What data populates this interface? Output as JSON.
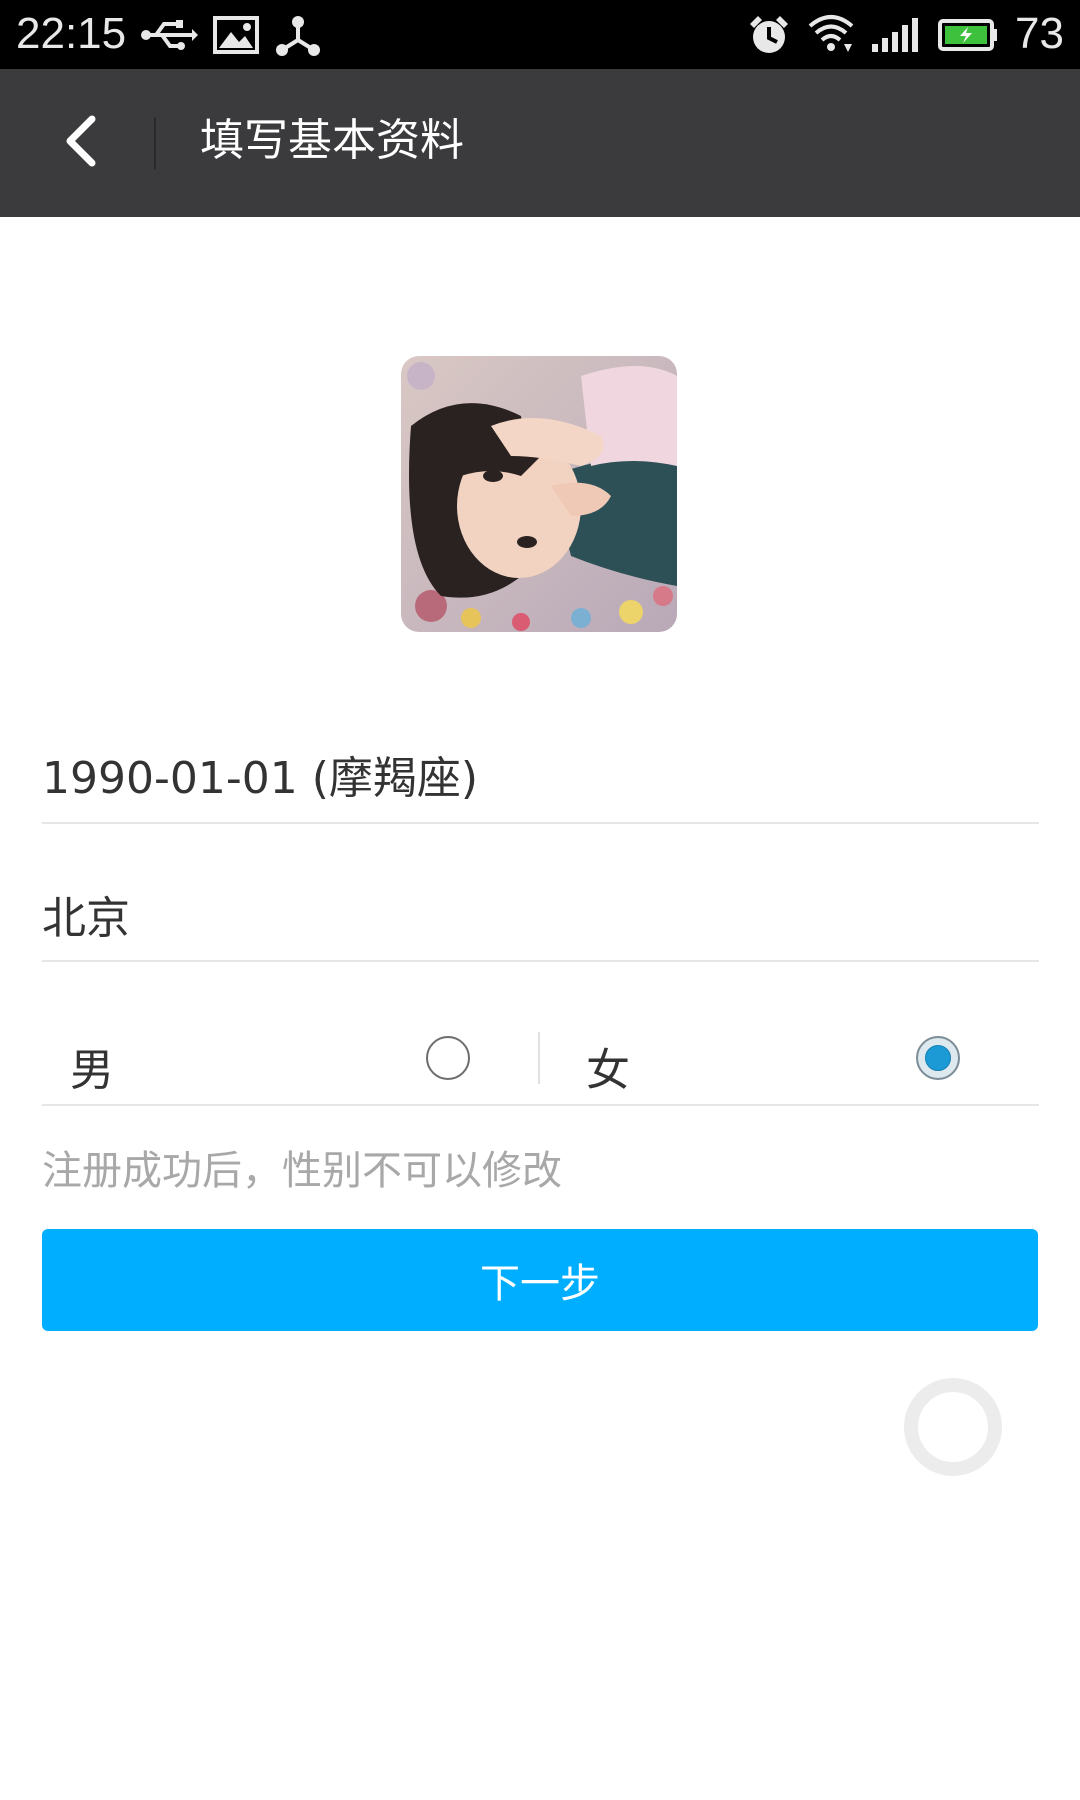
{
  "status_bar": {
    "time": "22:15",
    "battery": "73",
    "icons": [
      "usb-icon",
      "image-icon",
      "share-icon",
      "alarm-icon",
      "wifi-icon",
      "signal-icon",
      "battery-icon"
    ]
  },
  "header": {
    "title": "填写基本资料",
    "back_icon": "back-arrow-icon"
  },
  "avatar": {
    "description_icon": "avatar-photo"
  },
  "form": {
    "birthday": "1990-01-01 (摩羯座)",
    "city": "北京",
    "gender": {
      "male_label": "男",
      "female_label": "女",
      "selected": "女"
    },
    "hint": "注册成功后，性别不可以修改"
  },
  "actions": {
    "next_label": "下一步"
  },
  "colors": {
    "title_bar": "#3b3b3d",
    "primary": "#00aeff",
    "radio_selected": "#1c9ad6",
    "hint_text": "#a8a8a8"
  }
}
